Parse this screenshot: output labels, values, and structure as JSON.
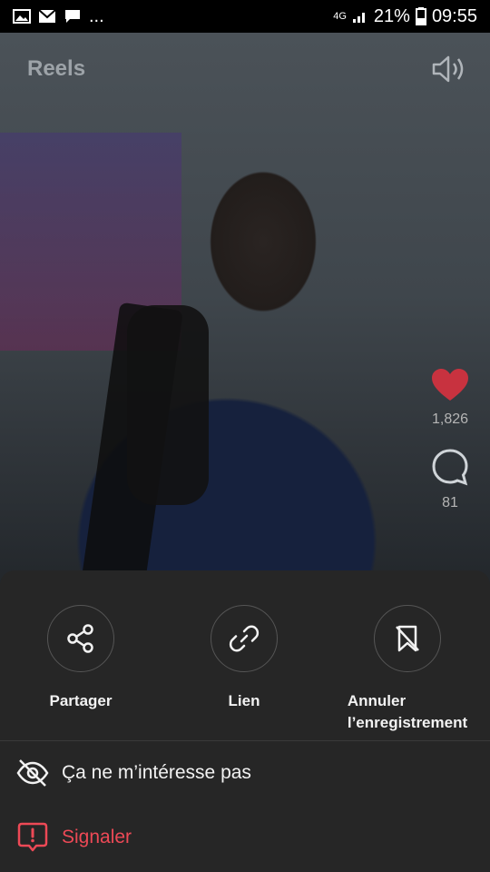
{
  "status_bar": {
    "network": "4G",
    "battery": "21%",
    "time": "09:55",
    "more": "..."
  },
  "header": {
    "title": "Reels"
  },
  "actions": {
    "likes": "1,826",
    "comments": "81"
  },
  "sheet": {
    "share_label": "Partager",
    "link_label": "Lien",
    "unsave_line1": "Annuler",
    "unsave_line2": "l’enregistrement",
    "not_interested_label": "Ça ne m’intéresse pas",
    "report_label": "Signaler"
  },
  "colors": {
    "like": "#ed4956",
    "danger": "#ed4956",
    "sheet_bg": "#262626"
  }
}
